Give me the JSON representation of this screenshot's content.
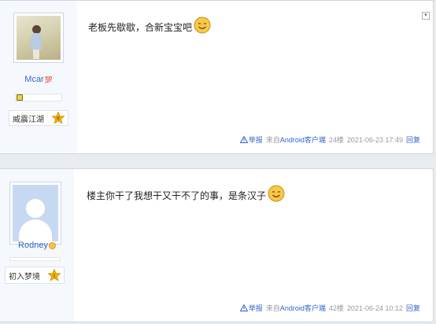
{
  "posts": [
    {
      "username": "Mcar",
      "username_mark": "💯",
      "rank_title": "威震江湖",
      "rank_level": "8",
      "message": "老板先歇歇，合新宝宝吧",
      "emoji": "smile-emoji",
      "report_label": "举报",
      "source_prefix": "来自",
      "source_client": "Android客户端",
      "floor": "24楼",
      "datetime": "2021-06-23 17:49",
      "reply_label": "回复"
    },
    {
      "username": "Rodney",
      "rank_title": "初入梦境",
      "rank_level": "1",
      "message": "楼主你干了我想干又干不了的事，是条汉子",
      "emoji": "smile-emoji",
      "report_label": "举报",
      "source_prefix": "来自",
      "source_client": "Android客户端",
      "floor": "42楼",
      "datetime": "2021-06-24 10:12",
      "reply_label": "回复"
    }
  ],
  "colors": {
    "link": "#3366cc",
    "sidebar_bg": "#f5f8fc",
    "page_bg": "#e9ecef"
  }
}
